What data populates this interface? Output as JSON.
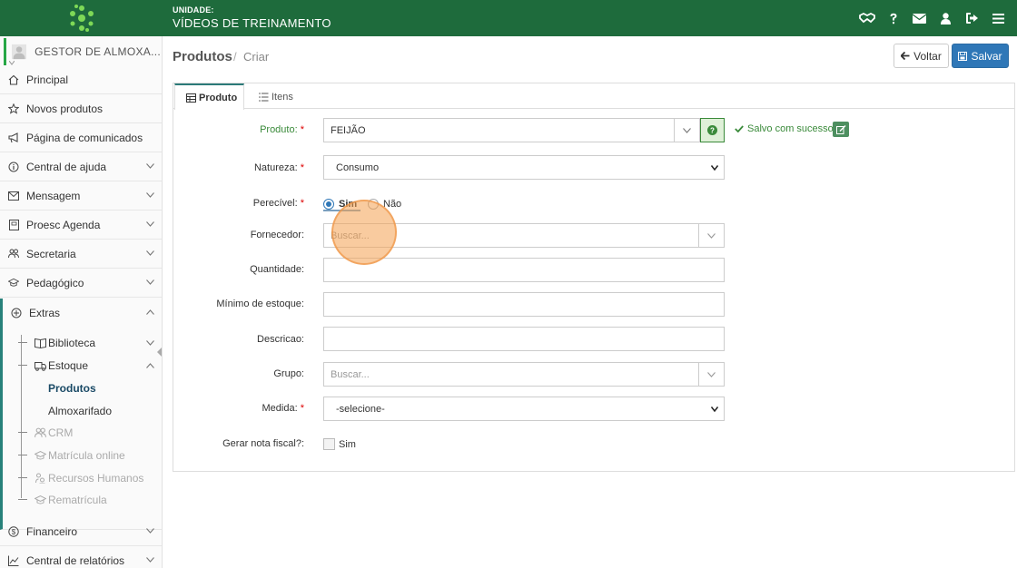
{
  "header": {
    "unit_label": "UNIDADE:",
    "unit_name": "VÍDEOS DE TREINAMENTO",
    "icons": [
      "handshake-icon",
      "question-icon",
      "envelope-icon",
      "user-icon",
      "sign-out-icon",
      "menu-icon"
    ]
  },
  "sidebar": {
    "user_name": "GESTOR DE ALMOXA...",
    "items": [
      {
        "label": "Principal",
        "icon": "home-icon"
      },
      {
        "label": "Novos produtos",
        "icon": "star-icon"
      },
      {
        "label": "Página de comunicados",
        "icon": "bullhorn-icon"
      },
      {
        "label": "Central de ajuda",
        "icon": "info-icon"
      },
      {
        "label": "Mensagem",
        "icon": "envelope-icon"
      },
      {
        "label": "Proesc Agenda",
        "icon": "book-icon"
      },
      {
        "label": "Secretaria",
        "icon": "users-icon"
      },
      {
        "label": "Pedagógico",
        "icon": "graduation-cap-icon"
      },
      {
        "label": "Extras",
        "icon": "plus-circle-icon"
      },
      {
        "label": "Financeiro",
        "icon": "dollar-circle-icon"
      },
      {
        "label": "Central de relatórios",
        "icon": "line-chart-icon"
      }
    ],
    "extras_sub": [
      {
        "label": "Biblioteca",
        "icon": "open-book-icon"
      },
      {
        "label": "Estoque",
        "icon": "truck-icon"
      },
      {
        "label": "CRM",
        "icon": "users-icon"
      },
      {
        "label": "Matrícula online",
        "icon": "graduation-cap-icon"
      },
      {
        "label": "Recursos Humanos",
        "icon": "sitemap-icon"
      },
      {
        "label": "Rematrícula",
        "icon": "graduation-cap-icon"
      }
    ],
    "estoque_sub": [
      {
        "label": "Produtos",
        "active": true
      },
      {
        "label": "Almoxarifado",
        "active": false
      }
    ]
  },
  "page": {
    "title": "Produtos",
    "separator": "/",
    "subtitle": "Criar",
    "back_label": "Voltar",
    "save_label": "Salvar"
  },
  "tabs": [
    {
      "label": "Produto",
      "icon": "table-icon",
      "active": true
    },
    {
      "label": "Itens",
      "icon": "list-icon",
      "active": false
    }
  ],
  "form": {
    "required_mark": "*",
    "produto": {
      "label": "Produto:",
      "value": "FEIJÃO",
      "status": "Salvo com sucesso"
    },
    "natureza": {
      "label": "Natureza:",
      "value": "Consumo"
    },
    "perecivel": {
      "label": "Perecível:",
      "option_yes": "Sim",
      "option_no": "Não",
      "selected": "Sim"
    },
    "fornecedor": {
      "label": "Fornecedor:",
      "placeholder": "Buscar..."
    },
    "quantidade": {
      "label": "Quantidade:",
      "value": ""
    },
    "minimo_estoque": {
      "label": "Mínimo de estoque:",
      "value": ""
    },
    "descricao": {
      "label": "Descricao:",
      "value": ""
    },
    "grupo": {
      "label": "Grupo:",
      "placeholder": "Buscar..."
    },
    "medida": {
      "label": "Medida:",
      "value": "-selecione-"
    },
    "gerar_nota": {
      "label": "Gerar nota fiscal?:",
      "option": "Sim",
      "checked": false
    }
  },
  "colors": {
    "header_bg": "#1e6b3c",
    "primary": "#2f77b7",
    "success": "#3a8a3a",
    "required": "#dd0000",
    "click_indicator": "#f4a050"
  }
}
